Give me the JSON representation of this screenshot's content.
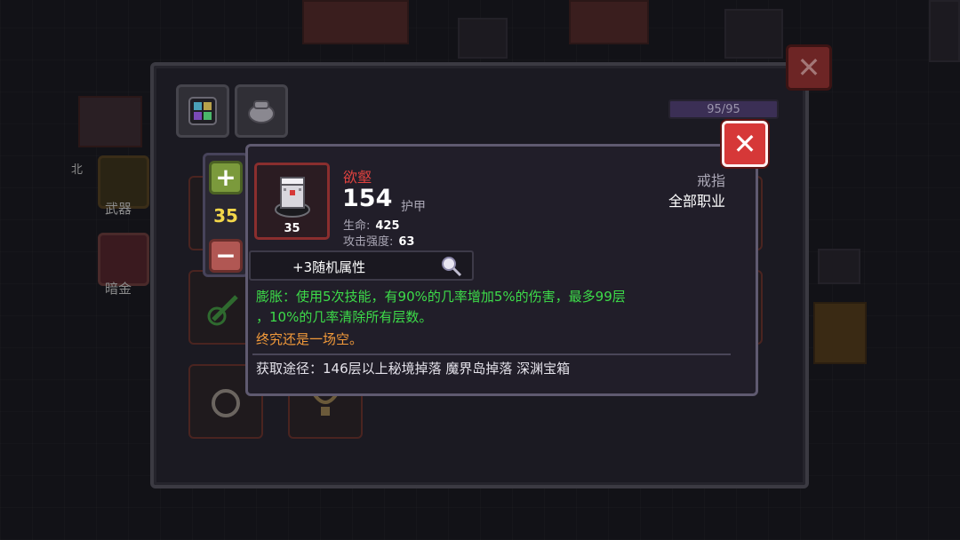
{
  "background": {
    "left_labels": [
      "北",
      "武器",
      "暗金"
    ]
  },
  "panel": {
    "hp_text": "95/95",
    "close_icon": "x-icon"
  },
  "stepper": {
    "plus_label": "+",
    "minus_label": "−",
    "value": "35"
  },
  "item": {
    "name": "欲壑",
    "icon_level": "35",
    "armor_value": "154",
    "armor_label": "护甲",
    "stats": [
      {
        "label": "生命:",
        "value": "425"
      },
      {
        "label": "攻击强度:",
        "value": "63"
      }
    ],
    "type": "戒指",
    "class": "全部职业",
    "random_attr": "+3随机属性",
    "effect_lines": [
      "膨胀：使用5次技能，有90%的几率增加5%的伤害，最多99层",
      "，10%的几率清除所有层数。"
    ],
    "flavor": "终究还是一场空。",
    "source": "获取途径：146层以上秘境掉落 魔界岛掉落 深渊宝箱"
  },
  "colors": {
    "name_red": "#e0423f",
    "effect_green": "#3ddc49",
    "flavor_orange": "#f29a3a",
    "level_yellow": "#f2d64a"
  }
}
